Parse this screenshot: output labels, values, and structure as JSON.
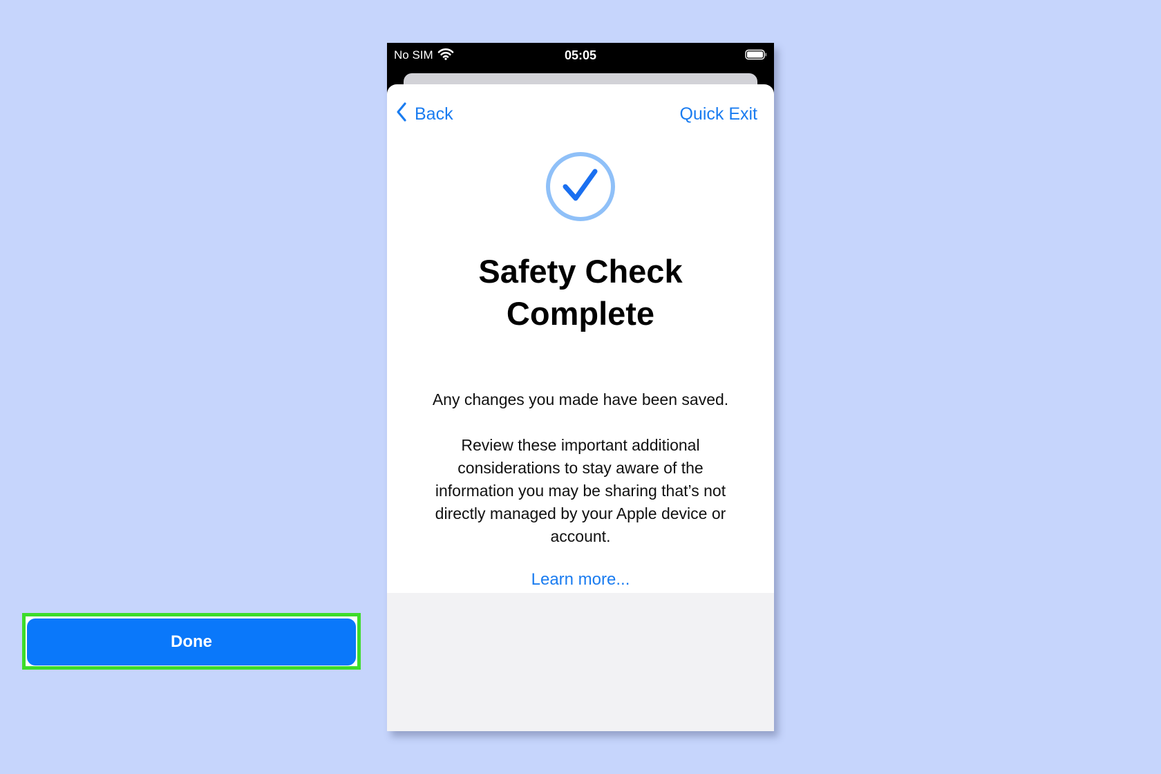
{
  "status_bar": {
    "carrier": "No SIM",
    "time": "05:05"
  },
  "nav": {
    "back_label": "Back",
    "quick_exit_label": "Quick Exit"
  },
  "content": {
    "title_line1": "Safety Check",
    "title_line2": "Complete",
    "subtitle": "Any changes you made have been saved.",
    "body_lines": [
      "Review these important additional",
      "considerations to stay aware of the",
      "information you may be sharing that’s not",
      "directly managed by your Apple device or",
      "account."
    ],
    "learn_more_label": "Learn more..."
  },
  "footer": {
    "done_label": "Done"
  },
  "icons": {
    "status": [
      "wifi-icon",
      "battery-icon"
    ],
    "nav": "chevron-left-icon",
    "hero": "checkmark-circle-icon"
  },
  "colors": {
    "background": "#c6d5fc",
    "accent": "#1a7cf0",
    "button": "#0a78fa",
    "highlight": "#3ddc2a",
    "check_ring": "#8fc0f8"
  }
}
